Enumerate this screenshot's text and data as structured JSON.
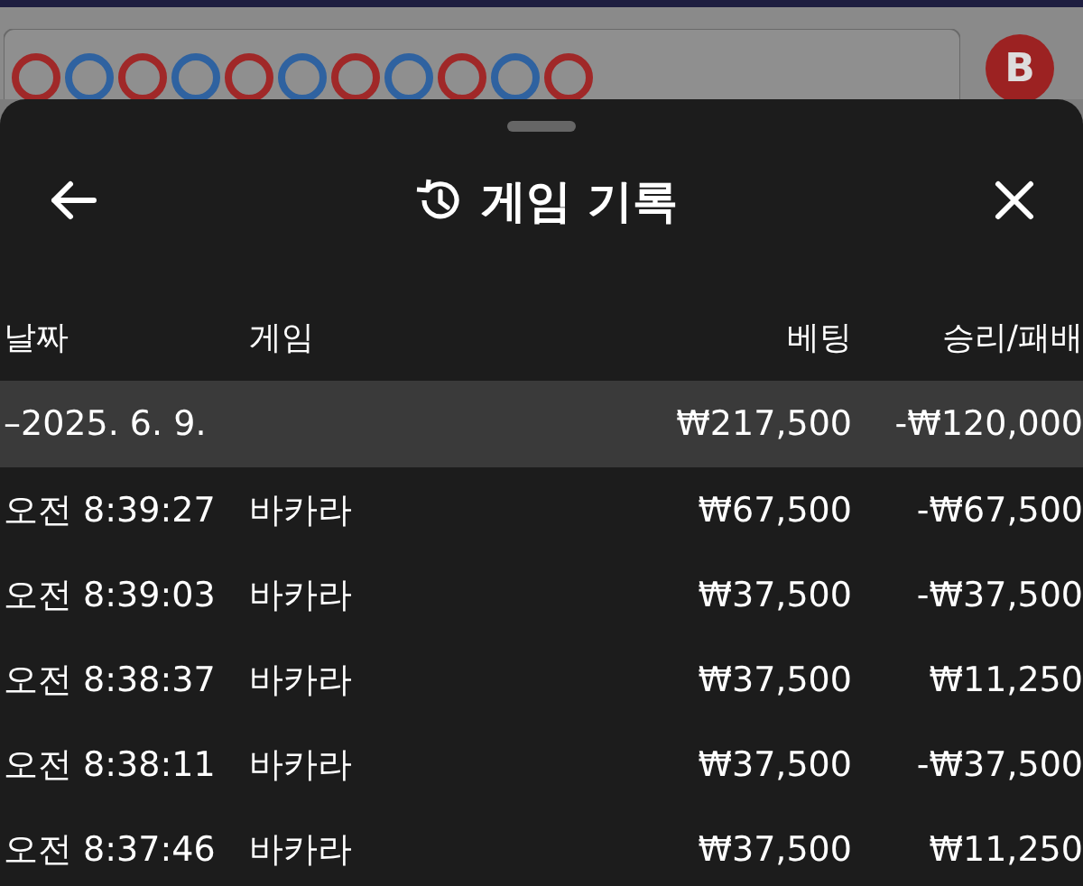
{
  "background": {
    "badge": "B"
  },
  "sheet": {
    "title": "게임 기록"
  },
  "table": {
    "columns": [
      "날짜",
      "게임",
      "베팅",
      "승리/패배"
    ],
    "groups": [
      {
        "date": "–2025. 6. 9.",
        "bet": "₩217,500",
        "result": "-₩120,000",
        "rows": [
          {
            "time": "오전 8:39:27",
            "game": "바카라",
            "bet": "₩67,500",
            "result": "-₩67,500"
          },
          {
            "time": "오전 8:39:03",
            "game": "바카라",
            "bet": "₩37,500",
            "result": "-₩37,500"
          },
          {
            "time": "오전 8:38:37",
            "game": "바카라",
            "bet": "₩37,500",
            "result": "₩11,250"
          },
          {
            "time": "오전 8:38:11",
            "game": "바카라",
            "bet": "₩37,500",
            "result": "-₩37,500"
          },
          {
            "time": "오전 8:37:46",
            "game": "바카라",
            "bet": "₩37,500",
            "result": "₩11,250"
          }
        ]
      }
    ]
  }
}
